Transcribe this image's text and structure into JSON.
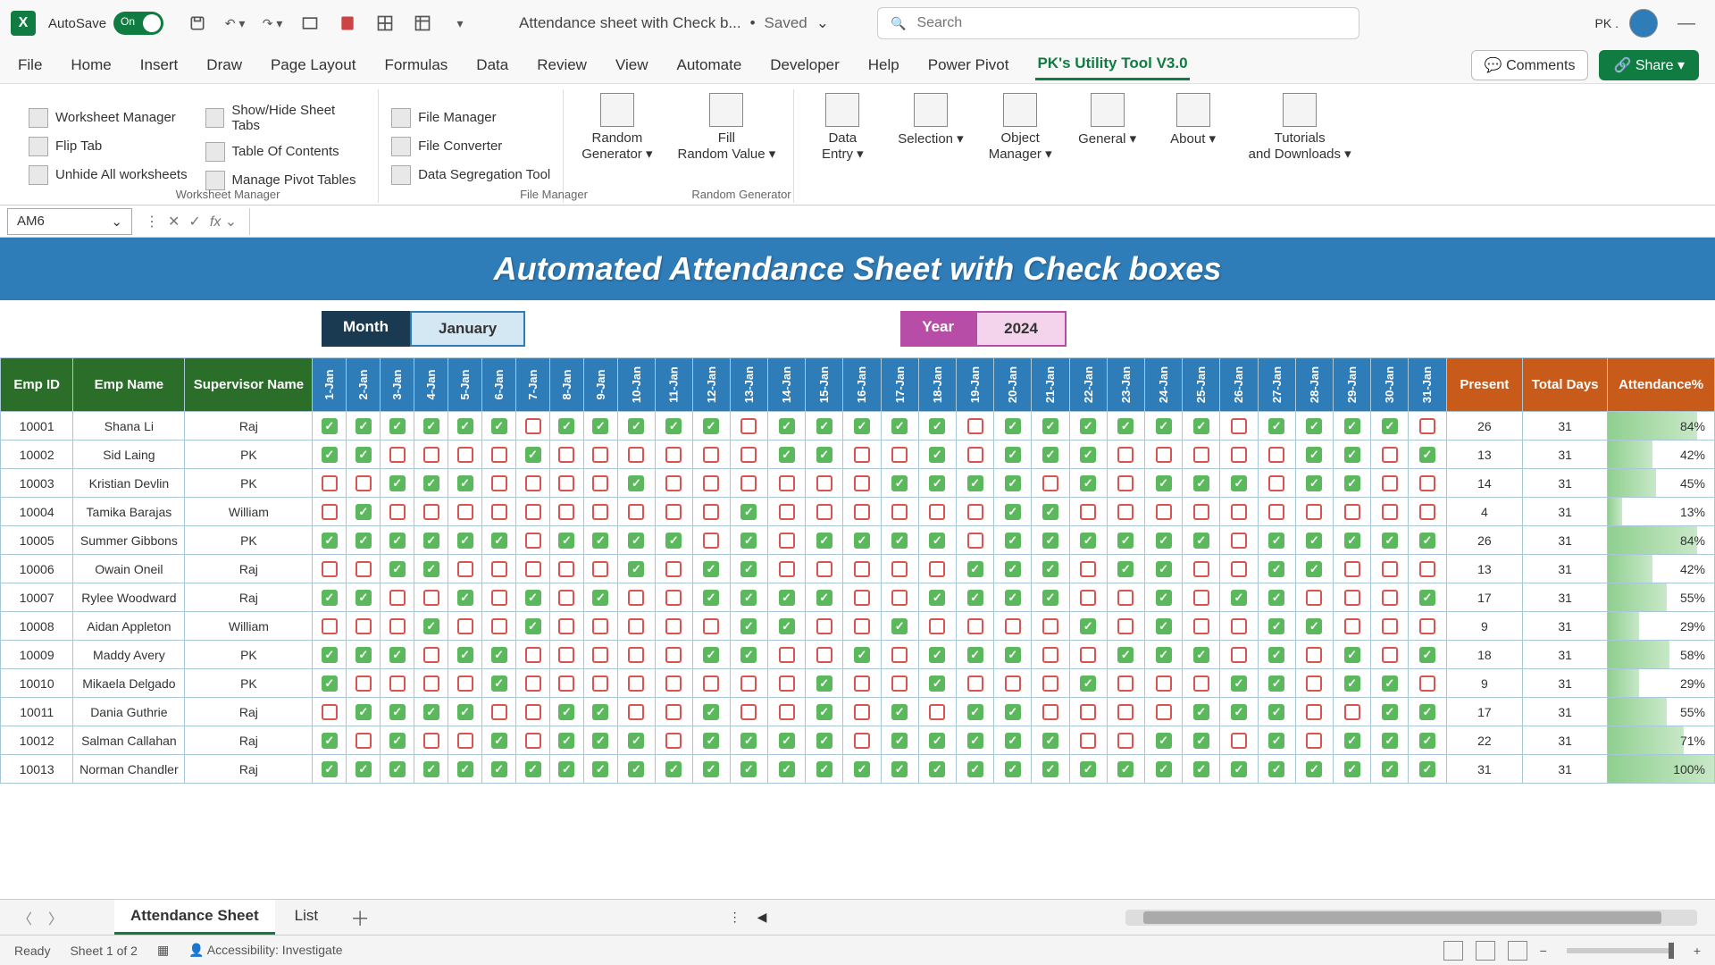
{
  "titlebar": {
    "autosave_label": "AutoSave",
    "filename": "Attendance sheet with Check b...",
    "save_status": "Saved",
    "search_placeholder": "Search",
    "user_initials": "PK ."
  },
  "ribbon_tabs": [
    "File",
    "Home",
    "Insert",
    "Draw",
    "Page Layout",
    "Formulas",
    "Data",
    "Review",
    "View",
    "Automate",
    "Developer",
    "Help",
    "Power Pivot",
    "PK's Utility Tool V3.0"
  ],
  "active_ribbon_tab": "PK's Utility Tool V3.0",
  "comments_label": "Comments",
  "share_label": "Share",
  "ribbon": {
    "g1": {
      "label": "Worksheet Manager",
      "items": [
        "Worksheet Manager",
        "Flip Tab",
        "Unhide All worksheets",
        "Show/Hide Sheet Tabs",
        "Table Of Contents",
        "Manage Pivot Tables"
      ]
    },
    "g2": {
      "label": "File Manager",
      "items": [
        "File Manager",
        "File Converter",
        "Data Segregation Tool"
      ]
    },
    "g3": {
      "label": "Random Generator",
      "items": [
        "Random Generator",
        "Fill Random Value"
      ]
    },
    "g4": [
      "Data Entry",
      "Selection",
      "Object Manager",
      "General",
      "About",
      "Tutorials and Downloads"
    ]
  },
  "name_box": "AM6",
  "sheet": {
    "title": "Automated Attendance Sheet with Check boxes",
    "month_label": "Month",
    "month_value": "January",
    "year_label": "Year",
    "year_value": "2024",
    "headers": {
      "id": "Emp ID",
      "name": "Emp Name",
      "sup": "Supervisor Name",
      "present": "Present",
      "total": "Total Days",
      "att": "Attendance%"
    },
    "days": [
      "1-Jan",
      "2-Jan",
      "3-Jan",
      "4-Jan",
      "5-Jan",
      "6-Jan",
      "7-Jan",
      "8-Jan",
      "9-Jan",
      "10-Jan",
      "11-Jan",
      "12-Jan",
      "13-Jan",
      "14-Jan",
      "15-Jan",
      "16-Jan",
      "17-Jan",
      "18-Jan",
      "19-Jan",
      "20-Jan",
      "21-Jan",
      "22-Jan",
      "23-Jan",
      "24-Jan",
      "25-Jan",
      "26-Jan",
      "27-Jan",
      "28-Jan",
      "29-Jan",
      "30-Jan",
      "31-Jan"
    ],
    "rows": [
      {
        "id": "10001",
        "name": "Shana Li",
        "sup": "Raj",
        "a": [
          1,
          1,
          1,
          1,
          1,
          1,
          0,
          1,
          1,
          1,
          1,
          1,
          0,
          1,
          1,
          1,
          1,
          1,
          0,
          1,
          1,
          1,
          1,
          1,
          1,
          0,
          1,
          1,
          1,
          1,
          0
        ],
        "p": 26,
        "t": 31,
        "pct": "84%"
      },
      {
        "id": "10002",
        "name": "Sid Laing",
        "sup": "PK",
        "a": [
          1,
          1,
          0,
          0,
          0,
          0,
          1,
          0,
          0,
          0,
          0,
          0,
          0,
          1,
          1,
          0,
          0,
          1,
          0,
          1,
          1,
          1,
          0,
          0,
          0,
          0,
          0,
          1,
          1,
          0,
          1
        ],
        "p": 13,
        "t": 31,
        "pct": "42%"
      },
      {
        "id": "10003",
        "name": "Kristian Devlin",
        "sup": "PK",
        "a": [
          0,
          0,
          1,
          1,
          1,
          0,
          0,
          0,
          0,
          1,
          0,
          0,
          0,
          0,
          0,
          0,
          1,
          1,
          1,
          1,
          0,
          1,
          0,
          1,
          1,
          1,
          0,
          1,
          1,
          0,
          0
        ],
        "p": 14,
        "t": 31,
        "pct": "45%"
      },
      {
        "id": "10004",
        "name": "Tamika Barajas",
        "sup": "William",
        "a": [
          0,
          1,
          0,
          0,
          0,
          0,
          0,
          0,
          0,
          0,
          0,
          0,
          1,
          0,
          0,
          0,
          0,
          0,
          0,
          1,
          1,
          0,
          0,
          0,
          0,
          0,
          0,
          0,
          0,
          0,
          0
        ],
        "p": 4,
        "t": 31,
        "pct": "13%"
      },
      {
        "id": "10005",
        "name": "Summer Gibbons",
        "sup": "PK",
        "a": [
          1,
          1,
          1,
          1,
          1,
          1,
          0,
          1,
          1,
          1,
          1,
          0,
          1,
          0,
          1,
          1,
          1,
          1,
          0,
          1,
          1,
          1,
          1,
          1,
          1,
          0,
          1,
          1,
          1,
          1,
          1
        ],
        "p": 26,
        "t": 31,
        "pct": "84%"
      },
      {
        "id": "10006",
        "name": "Owain Oneil",
        "sup": "Raj",
        "a": [
          0,
          0,
          1,
          1,
          0,
          0,
          0,
          0,
          0,
          1,
          0,
          1,
          1,
          0,
          0,
          0,
          0,
          0,
          1,
          1,
          1,
          0,
          1,
          1,
          0,
          0,
          1,
          1,
          0,
          0,
          0
        ],
        "p": 13,
        "t": 31,
        "pct": "42%"
      },
      {
        "id": "10007",
        "name": "Rylee Woodward",
        "sup": "Raj",
        "a": [
          1,
          1,
          0,
          0,
          1,
          0,
          1,
          0,
          1,
          0,
          0,
          1,
          1,
          1,
          1,
          0,
          0,
          1,
          1,
          1,
          1,
          0,
          0,
          1,
          0,
          1,
          1,
          0,
          0,
          0,
          1
        ],
        "p": 17,
        "t": 31,
        "pct": "55%"
      },
      {
        "id": "10008",
        "name": "Aidan Appleton",
        "sup": "William",
        "a": [
          0,
          0,
          0,
          1,
          0,
          0,
          1,
          0,
          0,
          0,
          0,
          0,
          1,
          1,
          0,
          0,
          1,
          0,
          0,
          0,
          0,
          1,
          0,
          1,
          0,
          0,
          1,
          1,
          0,
          0,
          0
        ],
        "p": 9,
        "t": 31,
        "pct": "29%"
      },
      {
        "id": "10009",
        "name": "Maddy Avery",
        "sup": "PK",
        "a": [
          1,
          1,
          1,
          0,
          1,
          1,
          0,
          0,
          0,
          0,
          0,
          1,
          1,
          0,
          0,
          1,
          0,
          1,
          1,
          1,
          0,
          0,
          1,
          1,
          1,
          0,
          1,
          0,
          1,
          0,
          1
        ],
        "p": 18,
        "t": 31,
        "pct": "58%"
      },
      {
        "id": "10010",
        "name": "Mikaela Delgado",
        "sup": "PK",
        "a": [
          1,
          0,
          0,
          0,
          0,
          1,
          0,
          0,
          0,
          0,
          0,
          0,
          0,
          0,
          1,
          0,
          0,
          1,
          0,
          0,
          0,
          1,
          0,
          0,
          0,
          1,
          1,
          0,
          1,
          1,
          0
        ],
        "p": 9,
        "t": 31,
        "pct": "29%"
      },
      {
        "id": "10011",
        "name": "Dania Guthrie",
        "sup": "Raj",
        "a": [
          0,
          1,
          1,
          1,
          1,
          0,
          0,
          1,
          1,
          0,
          0,
          1,
          0,
          0,
          1,
          0,
          1,
          0,
          1,
          1,
          0,
          0,
          0,
          0,
          1,
          1,
          1,
          0,
          0,
          1,
          1
        ],
        "p": 17,
        "t": 31,
        "pct": "55%"
      },
      {
        "id": "10012",
        "name": "Salman Callahan",
        "sup": "Raj",
        "a": [
          1,
          0,
          1,
          0,
          0,
          1,
          0,
          1,
          1,
          1,
          0,
          1,
          1,
          1,
          1,
          0,
          1,
          1,
          1,
          1,
          1,
          0,
          0,
          1,
          1,
          0,
          1,
          0,
          1,
          1,
          1
        ],
        "p": 22,
        "t": 31,
        "pct": "71%"
      },
      {
        "id": "10013",
        "name": "Norman Chandler",
        "sup": "Raj",
        "a": [
          1,
          1,
          1,
          1,
          1,
          1,
          1,
          1,
          1,
          1,
          1,
          1,
          1,
          1,
          1,
          1,
          1,
          1,
          1,
          1,
          1,
          1,
          1,
          1,
          1,
          1,
          1,
          1,
          1,
          1,
          1
        ],
        "p": 31,
        "t": 31,
        "pct": "100%"
      }
    ]
  },
  "sheet_tabs": [
    "Attendance Sheet",
    "List"
  ],
  "active_sheet_tab": "Attendance Sheet",
  "status": {
    "ready": "Ready",
    "sheet_info": "Sheet 1 of 2",
    "access": "Accessibility: Investigate"
  }
}
